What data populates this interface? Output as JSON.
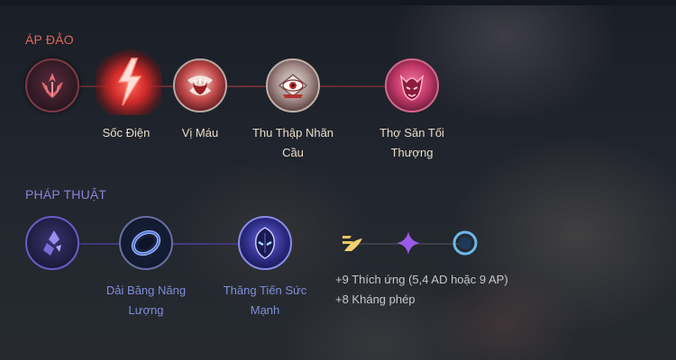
{
  "primary": {
    "title": "ÁP ĐẢO",
    "color": "#e2665c",
    "keystone_icon": "domination-icon",
    "runes": [
      {
        "name": "Sốc Điện",
        "icon": "electrocute-icon"
      },
      {
        "name": "Vị Máu",
        "icon": "taste-of-blood-icon"
      },
      {
        "name": "Thu Thập Nhãn Cầu",
        "icon": "eyeball-collection-icon"
      },
      {
        "name": "Thợ Săn Tối Thượng",
        "icon": "ultimate-hunter-icon"
      }
    ]
  },
  "secondary": {
    "title": "PHÁP THUẬT",
    "color": "#8e83d6",
    "keystone_icon": "sorcery-icon",
    "runes": [
      {
        "name": "Dải Băng Năng Lượng",
        "icon": "manaflow-band-icon"
      },
      {
        "name": "Thăng Tiến Sức Mạnh",
        "icon": "transcendence-icon"
      }
    ]
  },
  "shards": {
    "icons": [
      "adaptive-force-icon",
      "adaptive-force-icon",
      "magic-resist-icon"
    ],
    "lines": [
      "+9 Thích ứng (5,4 AD hoặc 9 AP)",
      "+8 Kháng phép"
    ]
  }
}
